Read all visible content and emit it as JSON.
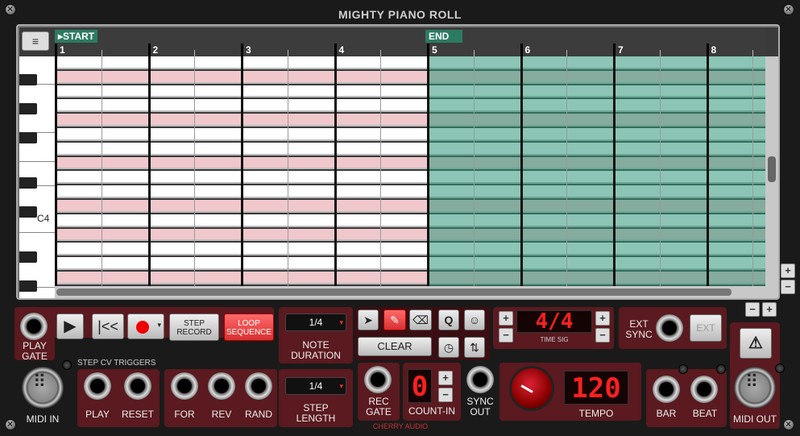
{
  "title": "MIGHTY PIANO ROLL",
  "roll": {
    "start_label": "START",
    "end_label": "END",
    "bars": [
      "1",
      "2",
      "3",
      "4",
      "5",
      "6",
      "7",
      "8"
    ],
    "c4_label": "C4",
    "menu_icon": "menu-icon",
    "loop_start_bar": 5
  },
  "zoom": {
    "v_plus": "+",
    "v_minus": "−",
    "h_minus": "−",
    "h_plus": "+"
  },
  "transport": {
    "play_gate_label": "PLAY\nGATE",
    "step_record_label": "STEP\nRECORD",
    "loop_sequence_label": "LOOP\nSEQUENCE"
  },
  "note_duration": {
    "value": "1/4",
    "label": "NOTE\nDURATION"
  },
  "step_length": {
    "value": "1/4",
    "label": "STEP\nLENGTH"
  },
  "tools": {
    "q_label": "Q",
    "clear_label": "CLEAR"
  },
  "time_sig": {
    "display": "4/4",
    "label": "TIME SIG"
  },
  "ext_sync": {
    "label": "EXT\nSYNC",
    "button_label": "EXT"
  },
  "midi_in_label": "MIDI IN",
  "midi_out_label": "MIDI OUT",
  "step_cv_label": "STEP CV TRIGGERS",
  "triggers": [
    "PLAY",
    "RESET",
    "FOR",
    "REV",
    "RAND"
  ],
  "rec_gate_label": "REC\nGATE",
  "count_in": {
    "value": "0",
    "label": "COUNT-IN"
  },
  "sync_out_label": "SYNC\nOUT",
  "tempo": {
    "value": "120",
    "label": "TEMPO"
  },
  "bar_label": "BAR",
  "beat_label": "BEAT",
  "brand": "CHERRY AUDIO",
  "colors": {
    "loop": "#2d9678",
    "panel": "#5a1a1f",
    "lcd_red": "#ff2020"
  }
}
